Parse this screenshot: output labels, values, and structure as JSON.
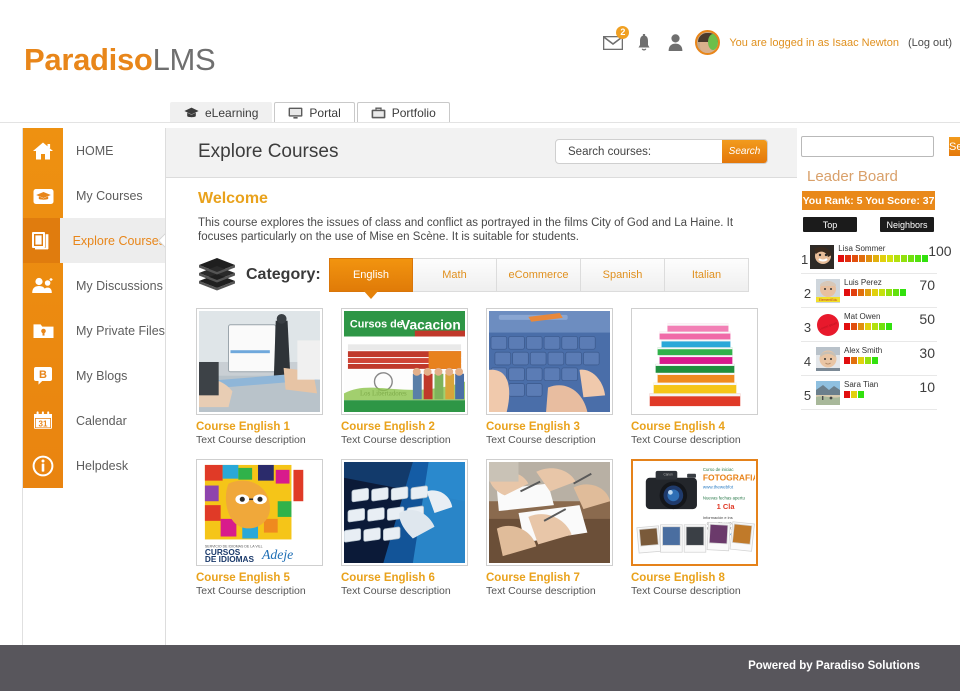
{
  "brand": {
    "name_bold": "Paradiso",
    "name_light": "LMS",
    "accent": "#E8861A"
  },
  "userbar": {
    "mail_badge": "2",
    "logged_in_text": "You are logged in as Isaac Newton",
    "logout_label": "(Log out)"
  },
  "product_tabs": [
    {
      "label": "eLearning",
      "icon": "graduation-cap-icon",
      "active": true
    },
    {
      "label": "Portal",
      "icon": "monitor-icon",
      "active": false
    },
    {
      "label": "Portfolio",
      "icon": "briefcase-icon",
      "active": false
    }
  ],
  "sidebar": {
    "items": [
      {
        "label": "HOME",
        "icon": "home-icon",
        "active": false
      },
      {
        "label": "My Courses",
        "icon": "graduation-cap-icon",
        "active": false
      },
      {
        "label": "Explore Courses",
        "icon": "books-icon",
        "active": true
      },
      {
        "label": "My Discussions",
        "icon": "people-icon",
        "active": false
      },
      {
        "label": "My Private Files",
        "icon": "folder-lock-icon",
        "active": false
      },
      {
        "label": "My Blogs",
        "icon": "blog-bubble-icon",
        "active": false
      },
      {
        "label": "Calendar",
        "icon": "calendar-icon",
        "active": false
      },
      {
        "label": "Helpdesk",
        "icon": "info-icon",
        "active": false
      }
    ]
  },
  "main": {
    "title": "Explore Courses",
    "search": {
      "placeholder": "Search courses:",
      "value": "",
      "button_label": "Search"
    },
    "welcome_heading": "Welcome",
    "welcome_body": "This course explores the issues of class and conflict as portrayed in the films  City of God and La Haine. It focuses particularly on the use of Mise en Scène.  It is suitable for students.",
    "category_label": "Category:",
    "category_tabs": [
      {
        "label": "English",
        "active": true
      },
      {
        "label": "Math",
        "active": false
      },
      {
        "label": "eCommerce",
        "active": false
      },
      {
        "label": "Spanish",
        "active": false
      },
      {
        "label": "Italian",
        "active": false
      }
    ],
    "courses": [
      {
        "title": "Course English 1",
        "description": "Text Course description",
        "thumb": "meeting-whiteboard",
        "selected": false
      },
      {
        "title": "Course English 2",
        "description": "Text Course description",
        "thumb": "cursos-vacaciones-poster",
        "selected": false
      },
      {
        "title": "Course English 3",
        "description": "Text Course description",
        "thumb": "blue-keyboard-typing",
        "selected": false
      },
      {
        "title": "Course English 4",
        "description": "Text Course description",
        "thumb": "stack-of-books",
        "selected": false
      },
      {
        "title": "Course English 5",
        "description": "Text Course description",
        "thumb": "cursos-de-idiomas-poster",
        "selected": false
      },
      {
        "title": "Course English 6",
        "description": "Text Course description",
        "thumb": "white-keyboard-blue",
        "selected": false
      },
      {
        "title": "Course English 7",
        "description": "Text Course description",
        "thumb": "hands-writing-exam",
        "selected": false
      },
      {
        "title": "Course English 8",
        "description": "Text Course description",
        "thumb": "camera-photography-poster",
        "selected": true
      }
    ]
  },
  "right_panel": {
    "search": {
      "value": "",
      "button_label": "Search",
      "icon": "magnifier-icon"
    },
    "leaderboard": {
      "title": "Leader Board",
      "status": "You Rank: 5   You Score: 37",
      "rank_value": "5",
      "score_value": "37",
      "buttons": [
        {
          "label": "Top",
          "active": true
        },
        {
          "label": "Neighbors",
          "active": false
        }
      ],
      "rows": [
        {
          "rank": "1",
          "name": "Lisa Sommer",
          "score": "100",
          "segments": 13,
          "avatar": "woman-smiling"
        },
        {
          "rank": "2",
          "name": "Luis Perez",
          "score": "70",
          "segments": 9,
          "avatar": "man-yellow-band"
        },
        {
          "rank": "3",
          "name": "Mat Owen",
          "score": "50",
          "segments": 7,
          "avatar": "red-circle"
        },
        {
          "rank": "4",
          "name": "Alex Smith",
          "score": "30",
          "segments": 5,
          "avatar": "man-portrait"
        },
        {
          "rank": "5",
          "name": "Sara Tian",
          "score": "10",
          "segments": 3,
          "avatar": "landscape-photo"
        }
      ]
    }
  },
  "footer": {
    "text": "Powered by Paradiso Solutions"
  }
}
